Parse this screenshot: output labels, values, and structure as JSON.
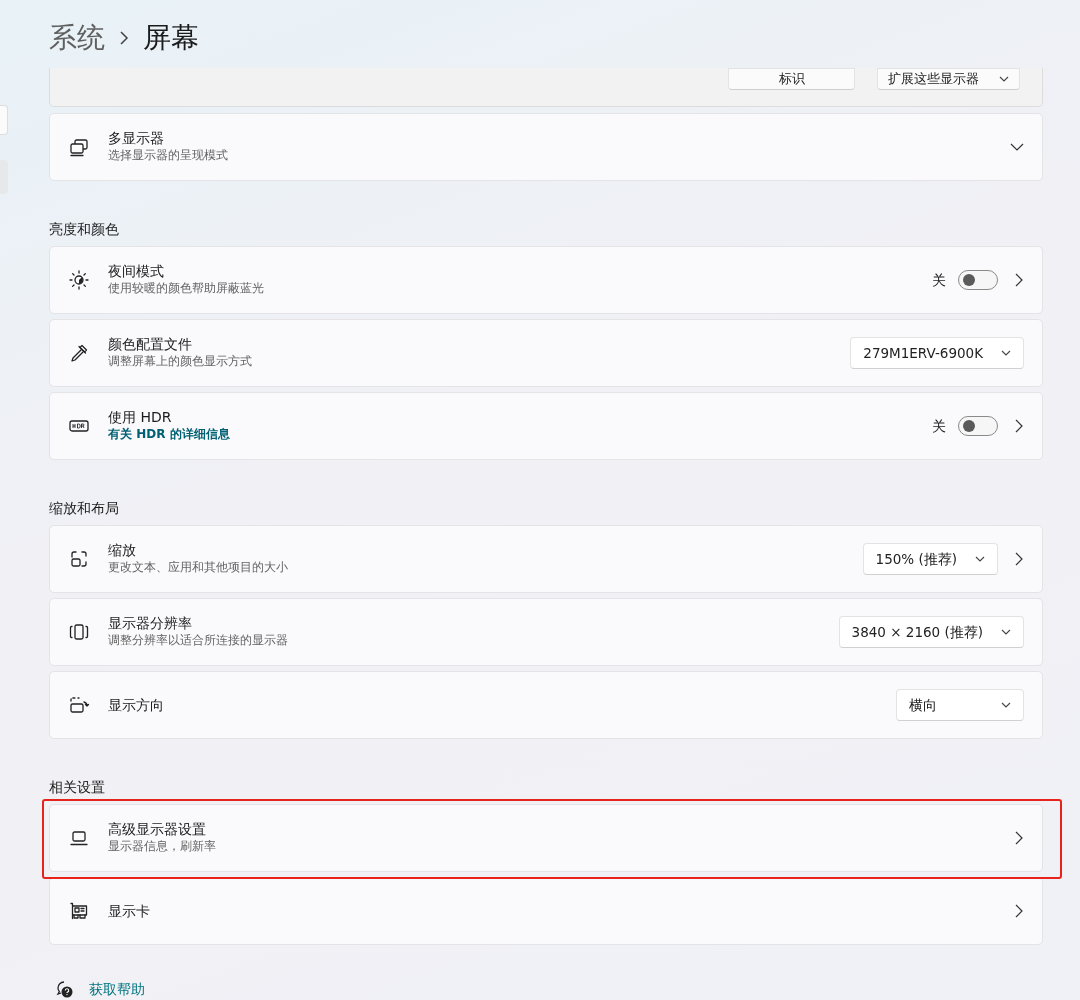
{
  "breadcrumb": {
    "parent": "系统",
    "current": "屏幕"
  },
  "top_card": {
    "buttons": [
      {
        "kind": "button",
        "label": "标识"
      },
      {
        "kind": "dropdown",
        "label": "扩展这些显示器"
      }
    ]
  },
  "sections": [
    {
      "rows": [
        {
          "title": "多显示器",
          "subtitle": {
            "text": "选择显示器的呈现模式",
            "link": false
          },
          "kind": "expander",
          "highlighted": false
        }
      ]
    },
    {
      "title": "亮度和颜色",
      "rows": [
        {
          "title": "夜间模式",
          "subtitle": {
            "text": "使用较暖的颜色帮助屏蔽蓝光",
            "link": false
          },
          "kind": "toggle",
          "state_label": "关",
          "on": false,
          "highlighted": false
        },
        {
          "title": "颜色配置文件",
          "subtitle": {
            "text": "调整屏幕上的颜色显示方式",
            "link": false
          },
          "kind": "dropdown",
          "value": "279M1ERV-6900K",
          "highlighted": false
        },
        {
          "title": "使用 HDR",
          "subtitle": {
            "text": "有关 HDR 的详细信息",
            "link": true
          },
          "kind": "toggle",
          "state_label": "关",
          "on": false,
          "highlighted": false
        }
      ]
    },
    {
      "title": "缩放和布局",
      "rows": [
        {
          "title": "缩放",
          "subtitle": {
            "text": "更改文本、应用和其他项目的大小",
            "link": false
          },
          "kind": "dropdown_chevron",
          "value": "150% (推荐)",
          "highlighted": false
        },
        {
          "title": "显示器分辨率",
          "subtitle": {
            "text": "调整分辨率以适合所连接的显示器",
            "link": false
          },
          "kind": "dropdown",
          "value": "3840 × 2160 (推荐)",
          "highlighted": false
        },
        {
          "title": "显示方向",
          "kind": "dropdown",
          "value": "横向",
          "highlighted": false
        }
      ]
    },
    {
      "title": "相关设置",
      "rows": [
        {
          "title": "高级显示器设置",
          "subtitle": {
            "text": "显示器信息，刷新率",
            "link": false
          },
          "kind": "chevron",
          "highlighted": true
        },
        {
          "title": "显示卡",
          "kind": "chevron",
          "highlighted": false
        }
      ]
    }
  ],
  "links": [
    {
      "label": "获取帮助"
    }
  ]
}
